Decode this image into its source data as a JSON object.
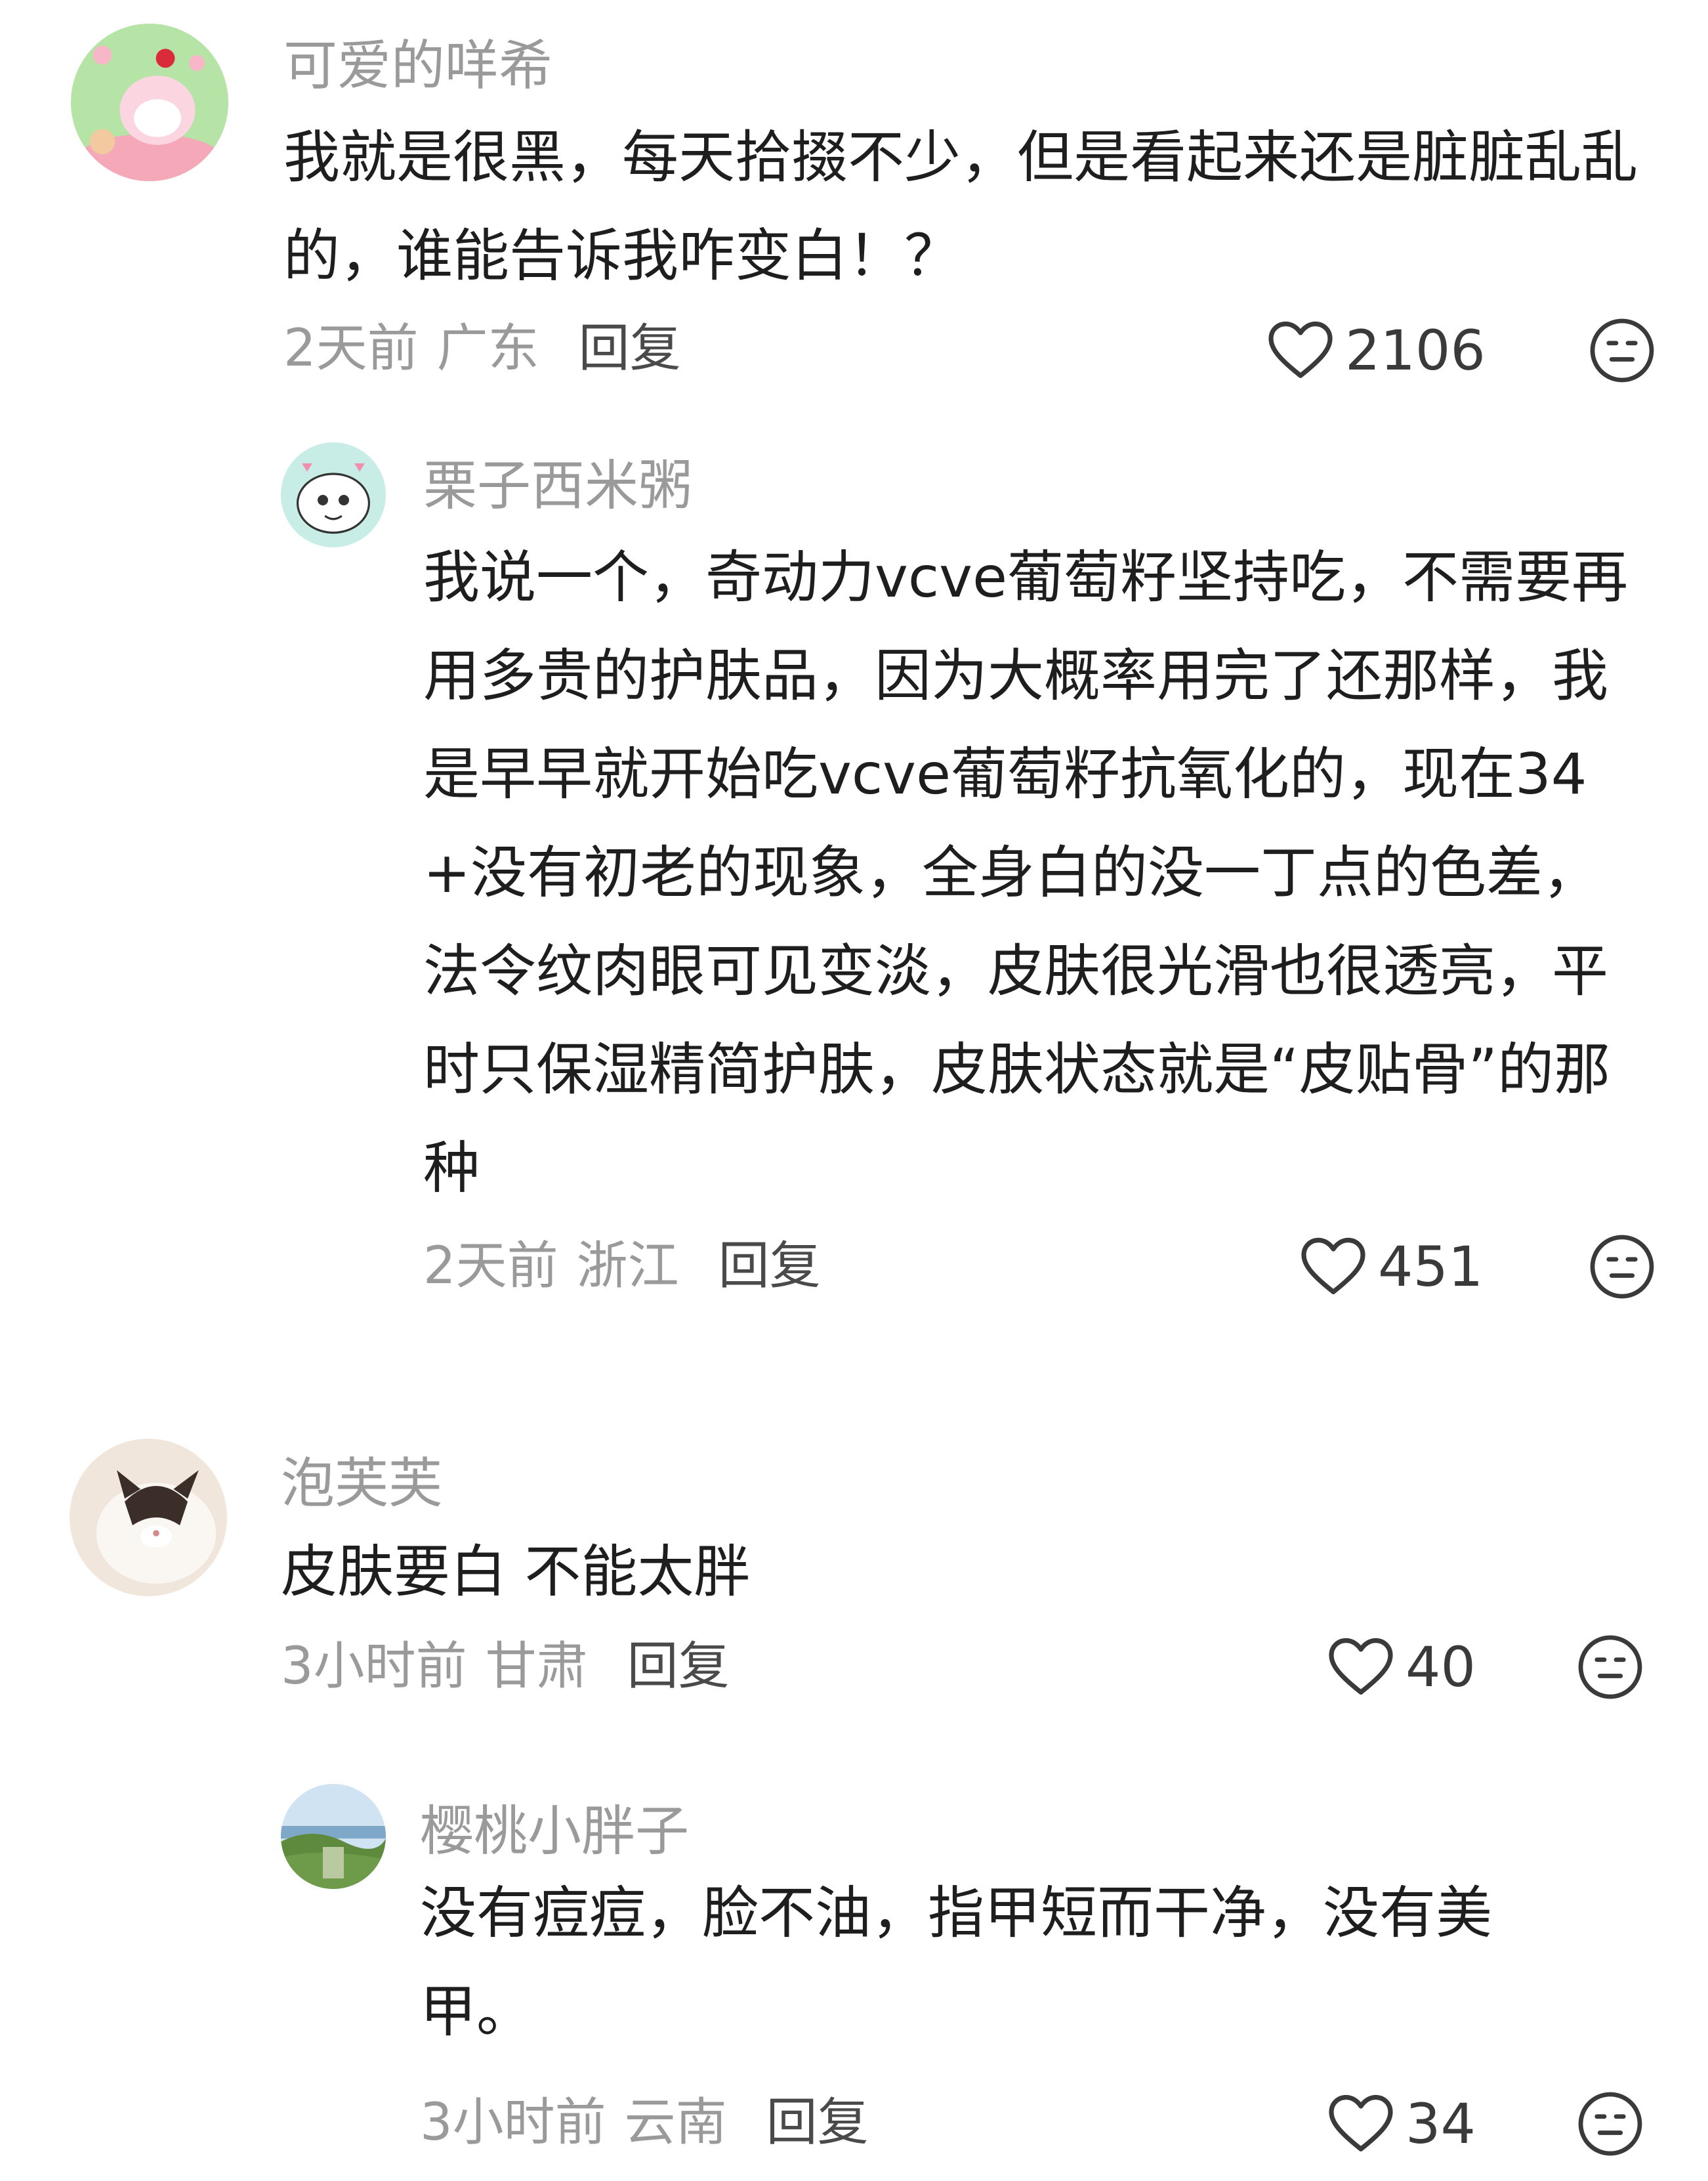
{
  "comments": [
    {
      "username": "可爱的咩希",
      "text": "我就是很黑，每天拾掇不少，但是看起来还是脏脏乱乱的，谁能告诉我咋变白！？",
      "time": "2天前",
      "location": "广东",
      "reply_label": "回复",
      "likes": "2106",
      "avatar_icon": "melody-avatar-icon"
    },
    {
      "username": "栗子西米粥",
      "text": "我说一个，奇动力vcve葡萄籽坚持吃，不需要再用多贵的护肤品，因为大概率用完了还那样，我是早早就开始吃vcve葡萄籽抗氧化的，现在34+没有初老的现象，全身白的没一丁点的色差，法令纹肉眼可见变淡，皮肤很光滑也很透亮，平时只保湿精简护肤，皮肤状态就是“皮贴骨”的那种",
      "time": "2天前",
      "location": "浙江",
      "reply_label": "回复",
      "likes": "451",
      "avatar_icon": "cartoon-dog-avatar-icon"
    },
    {
      "username": "泡芙芙",
      "text": "皮肤要白 不能太胖",
      "time": "3小时前",
      "location": "甘肃",
      "reply_label": "回复",
      "likes": "40",
      "avatar_icon": "cat-avatar-icon"
    },
    {
      "username": "樱桃小胖子",
      "text": "没有痘痘，脸不油，指甲短而干净，没有美甲。",
      "time": "3小时前",
      "location": "云南",
      "reply_label": "回复",
      "likes": "34",
      "avatar_icon": "landscape-avatar-icon"
    }
  ],
  "colors": {
    "username": "#9a9a9a",
    "body_text": "#1e1e1e",
    "meta": "#9a9a9a",
    "reply": "#4a4a4a",
    "icon": "#3a3a3a"
  }
}
